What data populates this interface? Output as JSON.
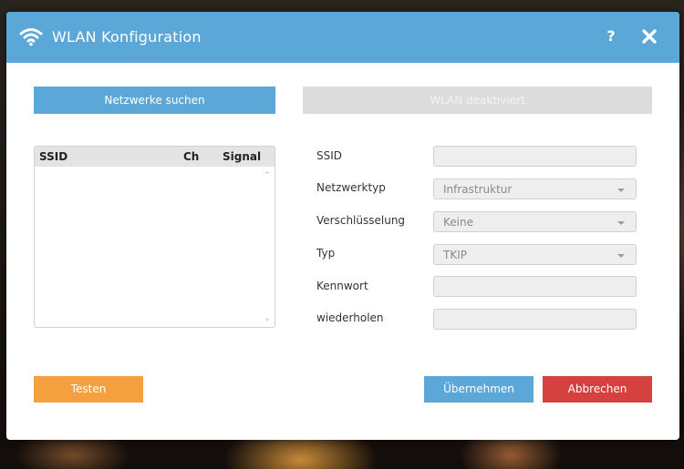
{
  "dialog": {
    "title": "WLAN Konfiguration",
    "help_label": "?"
  },
  "buttons": {
    "search": "Netzwerke suchen",
    "wlan_toggle": "WLAN deaktiviert",
    "test": "Testen",
    "apply": "Übernehmen",
    "cancel": "Abbrechen"
  },
  "network_list": {
    "columns": [
      "SSID",
      "Ch",
      "Signal"
    ],
    "rows": []
  },
  "form": {
    "ssid_label": "SSID",
    "ssid_value": "",
    "network_type_label": "Netzwerktyp",
    "network_type_value": "Infrastruktur",
    "encryption_label": "Verschlüsselung",
    "encryption_value": "Keine",
    "type_label": "Typ",
    "type_value": "TKIP",
    "password_label": "Kennwort",
    "password_value": "",
    "repeat_label": "wiederholen",
    "repeat_value": ""
  },
  "colors": {
    "accent_blue": "#5ba8d8",
    "orange": "#f5a03e",
    "red": "#d5413f",
    "disabled_gray": "#dcdcdc"
  },
  "icons": [
    "wifi-icon",
    "help-icon",
    "close-icon",
    "chevron-up-icon",
    "chevron-down-icon",
    "dropdown-caret-icon"
  ]
}
